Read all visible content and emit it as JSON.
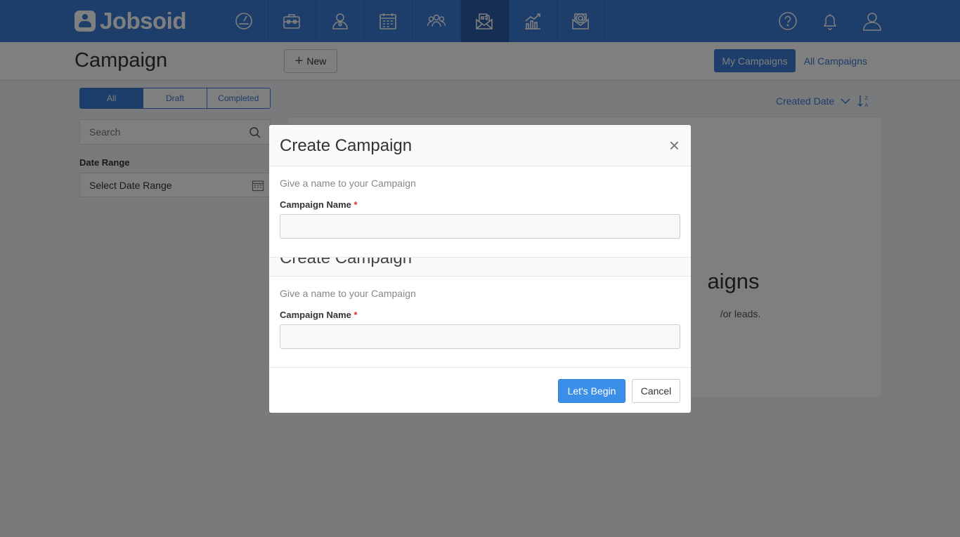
{
  "app": {
    "name": "Jobsoid"
  },
  "nav": {
    "icons": [
      "dashboard-icon",
      "jobs-icon",
      "candidates-icon",
      "calendar-icon",
      "talent-pool-icon",
      "campaign-icon",
      "reports-icon",
      "mail-icon"
    ],
    "active": "campaign-icon",
    "right_icons": [
      "help-icon",
      "notifications-icon",
      "profile-icon"
    ]
  },
  "page": {
    "title": "Campaign",
    "new_label": "New",
    "my_campaigns_label": "My Campaigns",
    "all_campaigns_label": "All Campaigns"
  },
  "filters": {
    "status_tabs": [
      "All",
      "Draft",
      "Completed"
    ],
    "active_tab": "All",
    "search_placeholder": "Search",
    "date_range_label": "Date Range",
    "date_range_value": "Select Date Range"
  },
  "sort": {
    "label": "Created Date"
  },
  "empty_state": {
    "title_fragment": "aigns",
    "subtitle_fragment": "/or leads."
  },
  "modal": {
    "title": "Create Campaign",
    "helper_text": "Give a name to your Campaign",
    "field_label": "Campaign Name",
    "required_mark": "*",
    "field_value": "",
    "begin_label": "Let's Begin",
    "cancel_label": "Cancel",
    "close_symbol": "×"
  },
  "colors": {
    "brand": "#3a7bd5",
    "brand_dark": "#2a5fa8",
    "primary_button": "#3b8fe8",
    "required": "#d9342b"
  }
}
